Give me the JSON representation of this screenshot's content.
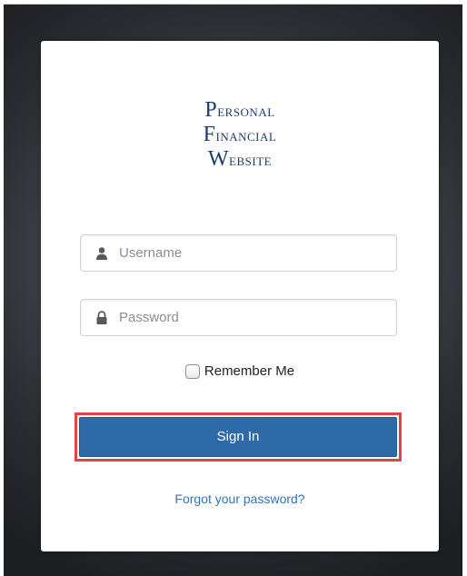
{
  "logo": {
    "line1": "Personal",
    "line2": "Financial",
    "line3": "Website"
  },
  "form": {
    "username": {
      "placeholder": "Username",
      "value": "",
      "icon": "user-icon"
    },
    "password": {
      "placeholder": "Password",
      "value": "",
      "icon": "lock-icon"
    },
    "remember_label": "Remember Me",
    "remember_checked": false,
    "signin_label": "Sign In",
    "forgot_label": "Forgot your password?"
  },
  "colors": {
    "brand_text": "#1f3b6b",
    "button": "#2f6aa8",
    "link": "#2f73b8",
    "highlight": "#e2434b"
  }
}
